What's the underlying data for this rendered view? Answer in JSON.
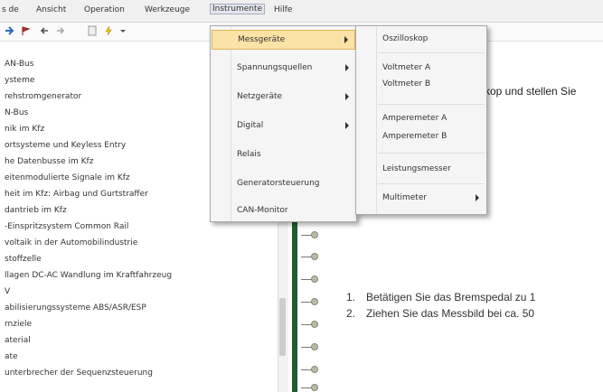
{
  "menubar": {
    "items": [
      {
        "label": "s de"
      },
      {
        "label": "Ansicht"
      },
      {
        "label": "Operation"
      },
      {
        "label": "Werkzeuge"
      },
      {
        "label": "Instrumente"
      },
      {
        "label": "Hilfe"
      }
    ]
  },
  "toolbar": {
    "icons": [
      "arrow-icon",
      "flag-icon",
      "back-icon",
      "forward-icon",
      "lightning-icon",
      "dropdown-icon"
    ]
  },
  "sidebar": {
    "items": [
      "AN-Bus",
      "ysteme",
      "rehstromgenerator",
      "N-Bus",
      "nik im Kfz",
      "ortsysteme und Keyless Entry",
      "he Datenbusse im Kfz",
      "eitenmodulierte Signale im Kfz",
      "heit im Kfz: Airbag und Gurtstraffer",
      "dantrieb im Kfz",
      "-Einspritzsystem Common Rail",
      "voltaik in der Automobilindustrie",
      "stoffzelle",
      "llagen DC-AC Wandlung im Kraftfahrzeug",
      "V",
      "abilisierungssysteme ABS/ASR/ESP",
      "rnziele",
      "aterial",
      "ate",
      "unterbrecher der Sequenzsteuerung"
    ]
  },
  "content": {
    "intro": "skop und stellen Sie",
    "steps": [
      {
        "num": "1.",
        "text": "Betätigen Sie das Bremspedal zu 1"
      },
      {
        "num": "2.",
        "text": "Ziehen Sie das Messbild bei ca. 50"
      }
    ]
  },
  "menus": {
    "instrumente": {
      "items": [
        {
          "label": "Messgeräte",
          "submenu": true
        },
        {
          "label": "Spannungsquellen",
          "submenu": true
        },
        {
          "label": "Netzgeräte",
          "submenu": true
        },
        {
          "label": "Digital",
          "submenu": true
        },
        {
          "label": "Relais",
          "submenu": false
        },
        {
          "label": "Generatorsteuerung",
          "submenu": false
        },
        {
          "label": "CAN-Monitor",
          "submenu": false
        }
      ]
    },
    "messgeraete": {
      "items": [
        {
          "label": "Oszilloskop",
          "submenu": false
        },
        {
          "label": "Voltmeter A",
          "submenu": false
        },
        {
          "label": "Voltmeter B",
          "submenu": false
        },
        {
          "label": "Amperemeter A",
          "submenu": false
        },
        {
          "label": "Amperemeter B",
          "submenu": false
        },
        {
          "label": "Leistungsmesser",
          "submenu": false
        },
        {
          "label": "Multimeter",
          "submenu": true
        }
      ]
    }
  },
  "colors": {
    "highlight_bg": "#fbe2a6",
    "highlight_border": "#e1b459",
    "rail": "#1f5e2c"
  }
}
